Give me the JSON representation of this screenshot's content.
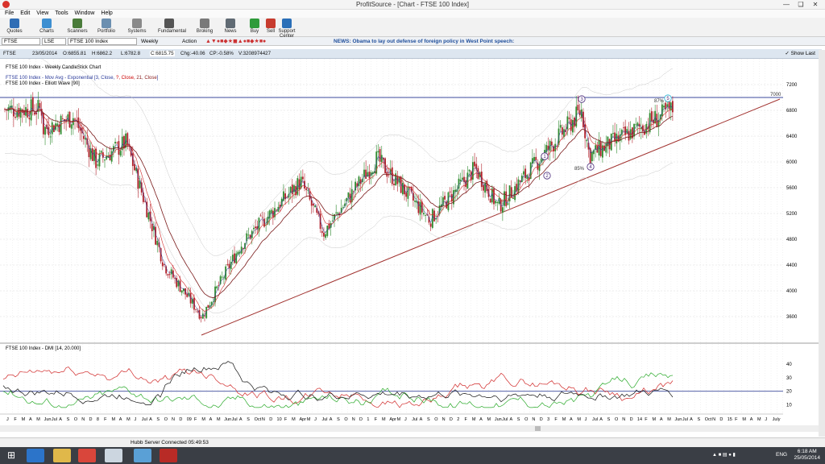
{
  "window": {
    "title": "ProfitSource - [Chart - FTSE 100 Index]"
  },
  "menu": [
    "File",
    "Edit",
    "View",
    "Tools",
    "Window",
    "Help"
  ],
  "toolbar": [
    {
      "label": "Quotes",
      "color": "#2f6db5"
    },
    {
      "label": "Charts",
      "color": "#3d8fd1"
    },
    {
      "label": "Scanners",
      "color": "#4a7c3a"
    },
    {
      "label": "Portfolio",
      "color": "#6b8fb0"
    },
    {
      "label": "Systems",
      "color": "#8a8a8a"
    },
    {
      "label": "Fundamental",
      "color": "#555"
    },
    {
      "label": "Broking",
      "color": "#7a7a7a"
    },
    {
      "label": "News",
      "color": "#606a73"
    },
    {
      "label": "Buy",
      "color": "#2e9b3a"
    },
    {
      "label": "Sell",
      "color": "#c73b2e"
    },
    {
      "label": "Support Center",
      "color": "#2a6fb8"
    }
  ],
  "symbol_bar": {
    "symbol": "FTSE",
    "exchange": "LSE",
    "name": "FTSE 100 Index",
    "period": "Weekly",
    "action": "Action",
    "news": "NEWS: Obama to lay out defense of foreign policy in West Point speech:"
  },
  "quote": {
    "symbol": "FTSE",
    "date": "23/05/2014",
    "open": "O:6855.81",
    "high": "H:6862.2",
    "low": "L:6782.8",
    "close": "C:6815.75",
    "chg": "Chg:-40.06",
    "chg_pct": "CP:-0.58%",
    "vol": "V:3208974427",
    "show_last": "Show Last"
  },
  "legend": {
    "title": "FTSE 100 Index - Weekly CandleStick Chart",
    "mavg_prefix": "FTSE 100 Index - Mov Avg - Exponential [",
    "mavg_a": "3, Close,",
    "mavg_b": "?, Close,",
    "mavg_c": "21, Close",
    "mavg_suffix": "]",
    "wave": "FTSE 100 Index - Elliott Wave [90]"
  },
  "dmi_legend": "FTSE 100 Index - DMI [14, 20.000]",
  "status": "Hubb Server Connected 05:49:53",
  "clock": {
    "time": "6:18 AM",
    "date": "25/05/2014",
    "lang": "ENG"
  },
  "chart_data": [
    {
      "type": "candlestick",
      "title": "FTSE 100 Index - Weekly CandleStick Chart",
      "y_ticks": [
        3600,
        4000,
        4400,
        4800,
        5200,
        5600,
        6000,
        6400,
        6800,
        7200
      ],
      "ylim": [
        3400,
        7350
      ],
      "series": [
        {
          "name": "close",
          "approx_points": [
            [
              "2007-06",
              6500
            ],
            [
              "2007-10",
              6700
            ],
            [
              "2008-01",
              6000
            ],
            [
              "2008-05",
              6300
            ],
            [
              "2008-10",
              4400
            ],
            [
              "2009-03",
              3600
            ],
            [
              "2009-08",
              4700
            ],
            [
              "2010-04",
              5700
            ],
            [
              "2010-07",
              4900
            ],
            [
              "2011-02",
              6050
            ],
            [
              "2011-09",
              5100
            ],
            [
              "2012-03",
              5900
            ],
            [
              "2012-06",
              5300
            ],
            [
              "2013-05",
              6800
            ],
            [
              "2013-06",
              6100
            ],
            [
              "2014-05",
              6815.75
            ]
          ]
        }
      ],
      "annotations": {
        "horizontal_line": 7000,
        "horizontal_label": "7000",
        "waves": [
          "1",
          "2",
          "3",
          "4",
          "5"
        ],
        "pct_labels": [
          "87%",
          "85%"
        ]
      }
    },
    {
      "type": "line",
      "title": "FTSE 100 Index - DMI [14, 20.000]",
      "y_ticks": [
        10,
        20,
        30,
        40
      ],
      "ylim": [
        5,
        50
      ],
      "threshold": 20
    },
    {
      "type": "axis",
      "x_labels": [
        "J",
        "F",
        "M",
        "A",
        "M",
        "Jun",
        "Jul",
        "A",
        "S",
        "O",
        "N",
        "D",
        "8",
        "F",
        "M",
        "A",
        "M",
        "J",
        "Jul",
        "A",
        "S",
        "O",
        "N",
        "D",
        "09",
        "F",
        "M",
        "A",
        "M",
        "Jun",
        "Jul",
        "A",
        "S",
        "Oct",
        "N",
        "D",
        "10",
        "F",
        "M",
        "Apr",
        "M",
        "J",
        "Jul",
        "A",
        "S",
        "O",
        "N",
        "D",
        "1",
        "F",
        "M",
        "Apr",
        "M",
        "J",
        "Jul",
        "A",
        "S",
        "O",
        "N",
        "D",
        "2",
        "F",
        "M",
        "A",
        "M",
        "Jun",
        "Jul",
        "A",
        "S",
        "O",
        "N",
        "D",
        "3",
        "F",
        "M",
        "A",
        "M",
        "J",
        "Jul",
        "A",
        "S",
        "O",
        "N",
        "D",
        "14",
        "F",
        "M",
        "A",
        "M",
        "Jun",
        "Jul",
        "A",
        "S",
        "Oct",
        "N",
        "D",
        "15",
        "F",
        "M",
        "A",
        "M",
        "J",
        "July"
      ]
    }
  ]
}
